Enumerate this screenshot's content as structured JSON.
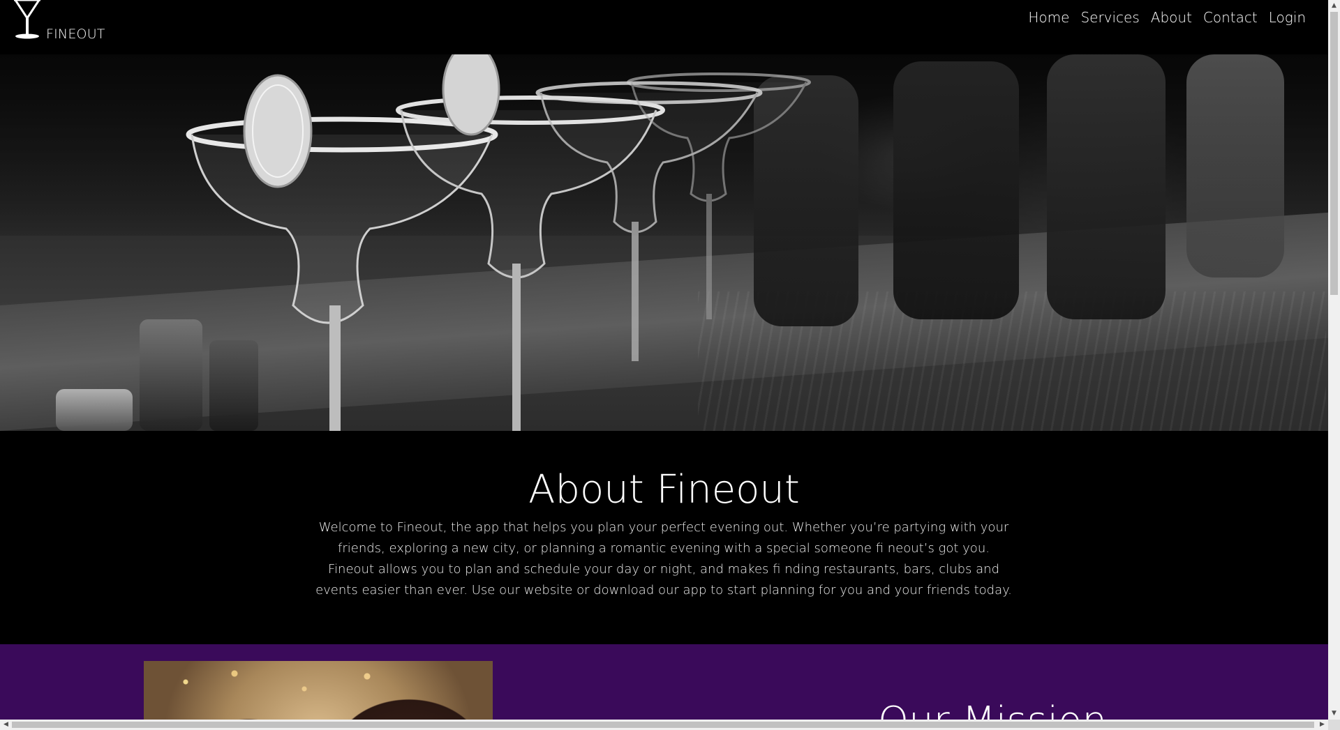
{
  "brand": {
    "name": "FINEOUT",
    "logo_icon": "cocktail-glass-icon"
  },
  "nav": {
    "items": [
      {
        "label": "Home"
      },
      {
        "label": "Services"
      },
      {
        "label": "About"
      },
      {
        "label": "Contact"
      },
      {
        "label": "Login"
      }
    ]
  },
  "hero": {
    "image": "margarita-glasses-on-bar-photo"
  },
  "about": {
    "title": "About Fineout",
    "text": "Welcome to Fineout, the app that helps you plan your perfect evening out. Whether you’re partying with your friends, exploring a new city, or planning a romantic evening with a special someone fi neout’s got you. Fineout allows you to plan and schedule your day or night, and makes fi nding restaurants, bars, clubs and events easier than ever. Use our website or download our app to start planning for you and your friends today."
  },
  "mission": {
    "title": "Our Mission",
    "image": "friends-at-party-photo",
    "background": "#3a0a5a"
  },
  "scrollbars": {
    "up": "▲",
    "down": "▼",
    "left": "◀",
    "right": "▶"
  }
}
